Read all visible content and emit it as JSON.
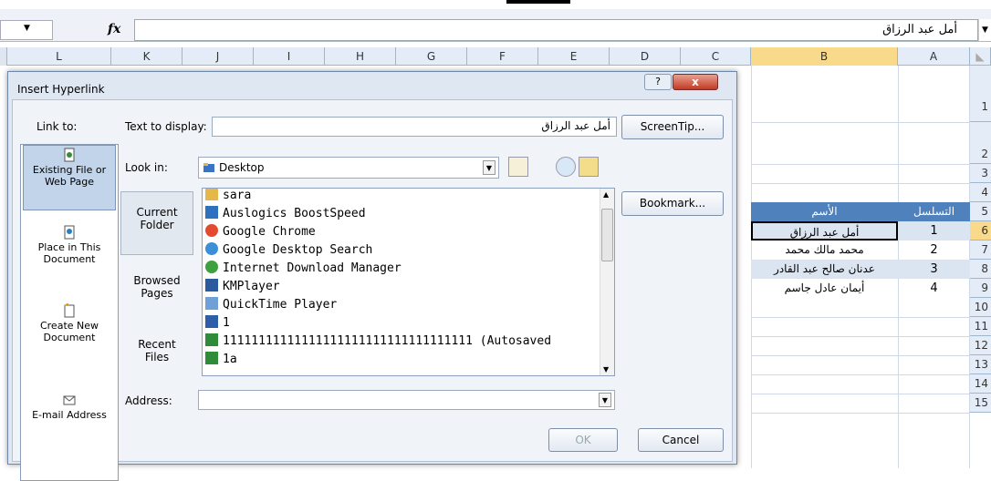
{
  "formula_bar": {
    "fx": "fx",
    "value": "أمل عبد الرزاق"
  },
  "columns": [
    "L",
    "K",
    "J",
    "I",
    "H",
    "G",
    "F",
    "E",
    "D",
    "C",
    "B",
    "A"
  ],
  "rows": [
    "1",
    "2",
    "3",
    "4",
    "5",
    "6",
    "7",
    "8",
    "9",
    "10",
    "11",
    "12",
    "13",
    "14",
    "15"
  ],
  "sheet": {
    "header": {
      "name": "الأسم",
      "seq": "التسلسل"
    },
    "data": [
      {
        "name": "أمل عبد الرزاق",
        "seq": "1"
      },
      {
        "name": "محمد مالك محمد",
        "seq": "2"
      },
      {
        "name": "عدنان صالح عبد القادر",
        "seq": "3"
      },
      {
        "name": "أيمان عادل جاسم",
        "seq": "4"
      }
    ]
  },
  "dialog": {
    "title": "Insert Hyperlink",
    "help": "?",
    "close": "x",
    "link_to_label": "Link to:",
    "link_to": [
      {
        "l1": "Existing File or",
        "l2": "Web Page"
      },
      {
        "l1": "Place in This",
        "l2": "Document"
      },
      {
        "l1": "Create New",
        "l2": "Document"
      },
      {
        "l1": "E-mail Address",
        "l2": ""
      }
    ],
    "text_to_display_label": "Text to display:",
    "text_to_display_value": "أمل عبد الرزاق",
    "screentip": "ScreenTip...",
    "look_in_label": "Look in:",
    "look_in_value": "Desktop",
    "side": [
      {
        "l1": "Current",
        "l2": "Folder"
      },
      {
        "l1": "Browsed",
        "l2": "Pages"
      },
      {
        "l1": "Recent",
        "l2": "Files"
      }
    ],
    "bookmark": "Bookmark...",
    "files": [
      "sara",
      "Auslogics BoostSpeed",
      "Google Chrome",
      "Google Desktop Search",
      "Internet Download Manager",
      "KMPlayer",
      "QuickTime Player",
      "1",
      "11111111111111111111111111111111111 (Autosaved",
      "1a"
    ],
    "address_label": "Address:",
    "address_value": "",
    "ok": "OK",
    "cancel": "Cancel"
  }
}
